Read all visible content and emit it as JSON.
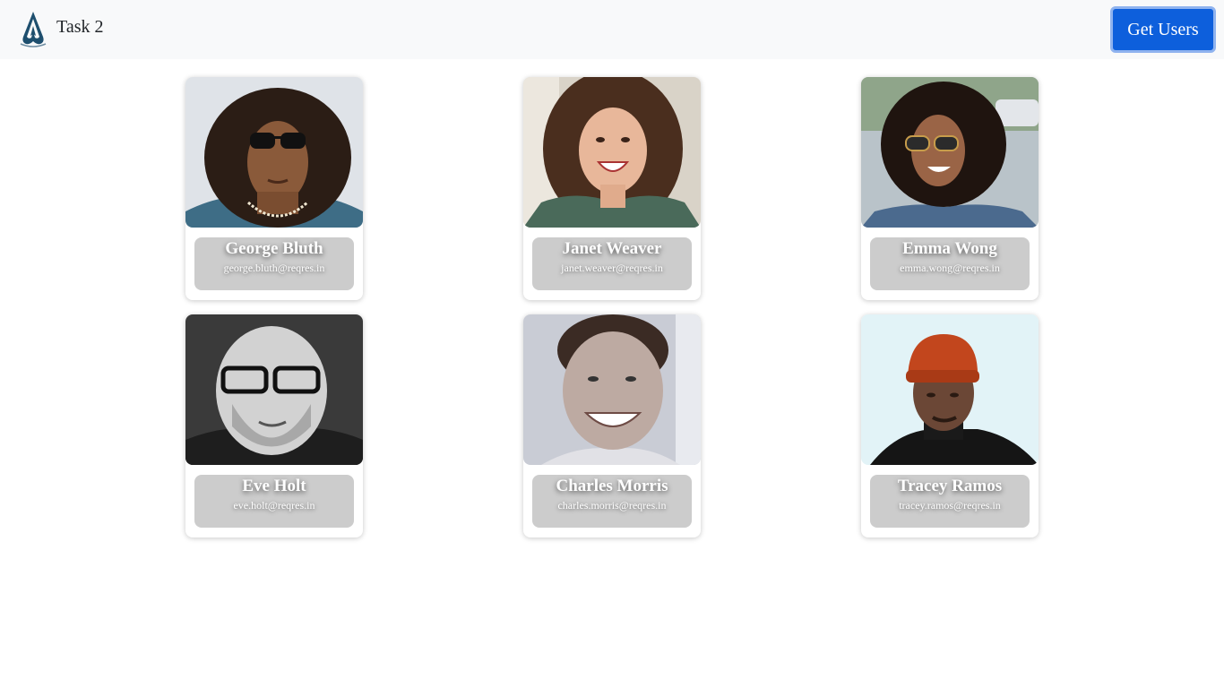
{
  "navbar": {
    "brand_text": "Task 2",
    "logo_icon": "assassin-emblem-icon",
    "get_users_label": "Get Users",
    "button_color": "#0d5fdc"
  },
  "users": [
    {
      "name": "George Bluth",
      "email": "george.bluth@reqres.in",
      "avatar": "man-curly-hair-sunglasses"
    },
    {
      "name": "Janet Weaver",
      "email": "janet.weaver@reqres.in",
      "avatar": "woman-smiling-brown-hair"
    },
    {
      "name": "Emma Wong",
      "email": "emma.wong@reqres.in",
      "avatar": "woman-curly-hair-sunglasses"
    },
    {
      "name": "Eve Holt",
      "email": "eve.holt@reqres.in",
      "avatar": "bald-man-glasses-beard"
    },
    {
      "name": "Charles Morris",
      "email": "charles.morris@reqres.in",
      "avatar": "man-smiling-dark-hair"
    },
    {
      "name": "Tracey Ramos",
      "email": "tracey.ramos@reqres.in",
      "avatar": "man-orange-beanie"
    }
  ]
}
